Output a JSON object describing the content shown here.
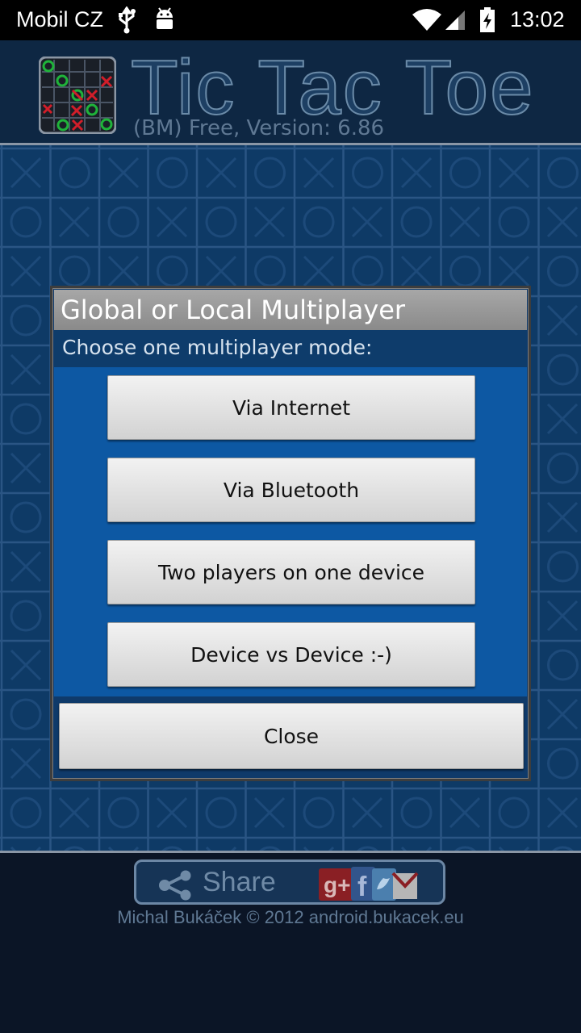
{
  "status_bar": {
    "carrier": "Mobil CZ",
    "time": "13:02"
  },
  "header": {
    "title": "Tic Tac Toe",
    "version": "(BM) Free, Version: 6.86"
  },
  "dialog": {
    "title": "Global or Local Multiplayer",
    "subtitle": "Choose one multiplayer mode:",
    "options": [
      {
        "label": "Via Internet"
      },
      {
        "label": "Via Bluetooth"
      },
      {
        "label": "Two players on one device"
      },
      {
        "label": "Device vs Device :-)"
      }
    ],
    "close_label": "Close"
  },
  "footer": {
    "share_label": "Share",
    "copyright": "Michal Bukáček © 2012 android.bukacek.eu"
  },
  "colors": {
    "board_bg": "#0e3a66",
    "dialog_options_bg": "#0d58a3",
    "title_bar": "#9a9a9a"
  }
}
